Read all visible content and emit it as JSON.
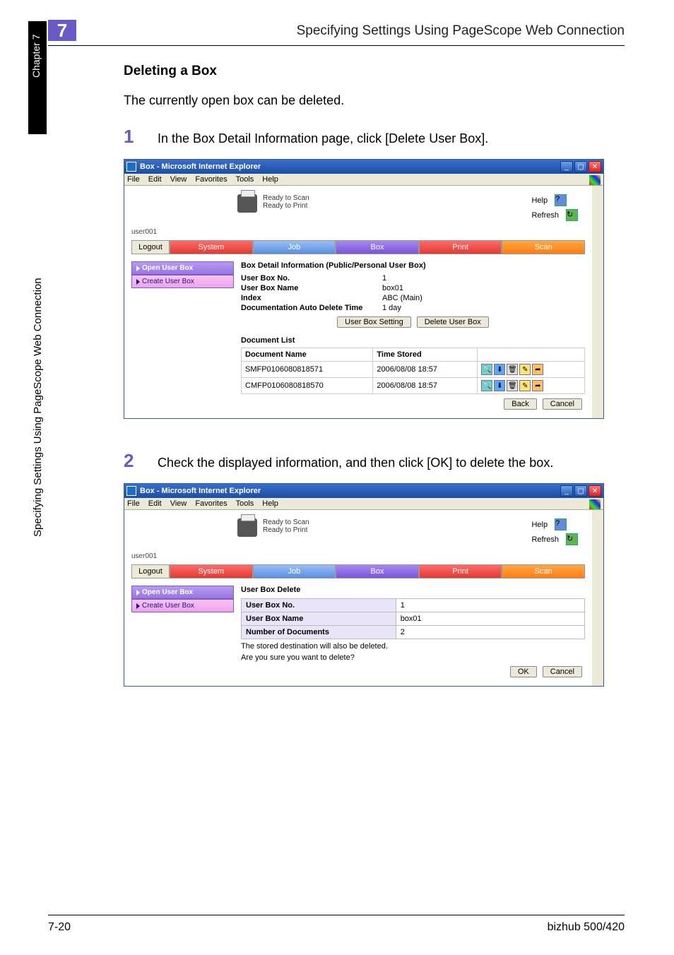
{
  "chapter_marker": "7",
  "running_header": "Specifying Settings Using PageScope Web Connection",
  "side_tab": "Chapter 7",
  "side_long": "Specifying Settings Using PageScope Web Connection",
  "heading": "Deleting a Box",
  "intro": "The currently open box can be deleted.",
  "steps": [
    "In the Box Detail Information page, click [Delete User Box].",
    "Check the displayed information, and then click [OK] to delete the box."
  ],
  "ie": {
    "title": "Box - Microsoft Internet Explorer",
    "menu": [
      "File",
      "Edit",
      "View",
      "Favorites",
      "Tools",
      "Help"
    ],
    "status": {
      "scan": "Ready to Scan",
      "print": "Ready to Print"
    },
    "help": "Help",
    "refresh": "Refresh",
    "user": "user001",
    "tabs": {
      "logout": "Logout",
      "system": "System",
      "job": "Job",
      "box": "Box",
      "print": "Print",
      "scan": "Scan"
    },
    "sidenav": {
      "open": "Open User Box",
      "create": "Create User Box"
    }
  },
  "detail": {
    "title": "Box Detail Information (Public/Personal User Box)",
    "k1": "User Box No.",
    "v1": "1",
    "k2": "User Box Name",
    "v2": "box01",
    "k3": "Index",
    "v3": "ABC (Main)",
    "k4": "Documentation Auto Delete Time",
    "v4": "1 day",
    "btn_setting": "User Box Setting",
    "btn_delete": "Delete User Box",
    "doclist_title": "Document List",
    "th1": "Document Name",
    "th2": "Time Stored",
    "rows": [
      {
        "name": "SMFP0106080818571",
        "time": "2006/08/08  18:57"
      },
      {
        "name": "CMFP0106080818570",
        "time": "2006/08/08  18:57"
      }
    ],
    "btn_back": "Back",
    "btn_cancel": "Cancel"
  },
  "delete": {
    "title": "User Box Delete",
    "k1": "User Box No.",
    "v1": "1",
    "k2": "User Box Name",
    "v2": "box01",
    "k3": "Number of Documents",
    "v3": "2",
    "note1": "The stored destination will also be deleted.",
    "note2": "Are you sure you want to delete?",
    "btn_ok": "OK",
    "btn_cancel": "Cancel"
  },
  "footer": {
    "left": "7-20",
    "right": "bizhub 500/420"
  }
}
